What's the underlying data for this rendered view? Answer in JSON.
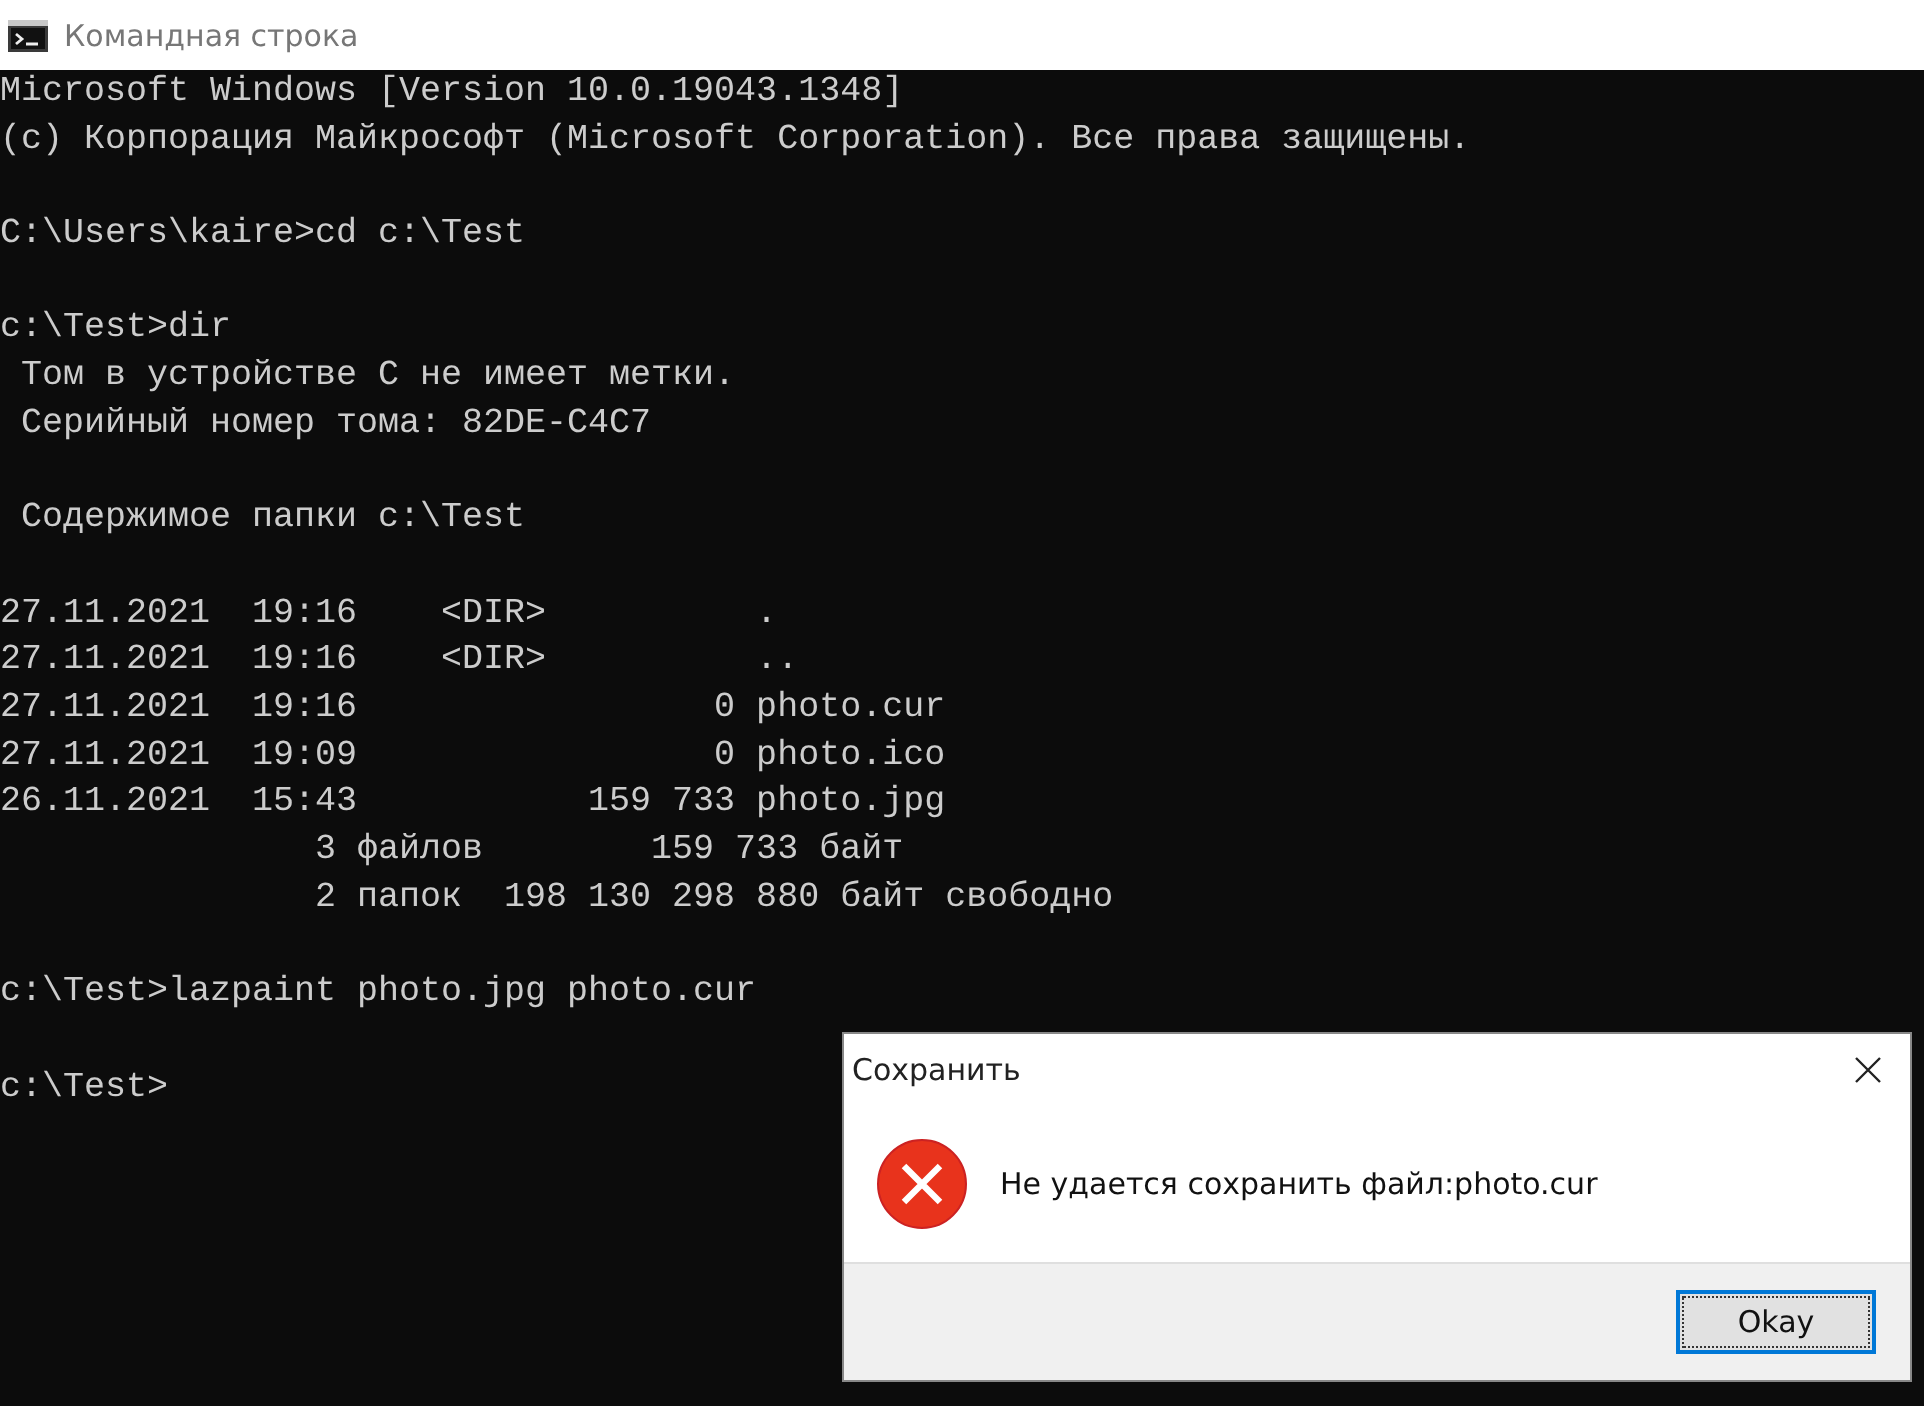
{
  "window": {
    "title": "Командная строка"
  },
  "console": {
    "blocks": [
      [
        "Microsoft Windows [Version 10.0.19043.1348]",
        "(c) Корпорация Майкрософт (Microsoft Corporation). Все права защищены."
      ],
      [
        "C:\\Users\\kaire>cd c:\\Test"
      ],
      [
        "c:\\Test>dir",
        " Том в устройстве C не имеет метки.",
        " Серийный номер тома: 82DE-C4C7"
      ],
      [
        " Содержимое папки c:\\Test"
      ],
      [
        "27.11.2021  19:16    <DIR>          .",
        "27.11.2021  19:16    <DIR>          ..",
        "27.11.2021  19:16                 0 photo.cur",
        "27.11.2021  19:09                 0 photo.ico",
        "26.11.2021  15:43           159 733 photo.jpg",
        "               3 файлов        159 733 байт",
        "               2 папок  198 130 298 880 байт свободно"
      ],
      [
        "c:\\Test>lazpaint photo.jpg photo.cur"
      ],
      [
        "c:\\Test>"
      ]
    ]
  },
  "dialog": {
    "title": "Сохранить",
    "message": "Не удается сохранить файл:photo.cur",
    "buttons": [
      {
        "label": "Okay",
        "selected": true
      }
    ]
  }
}
